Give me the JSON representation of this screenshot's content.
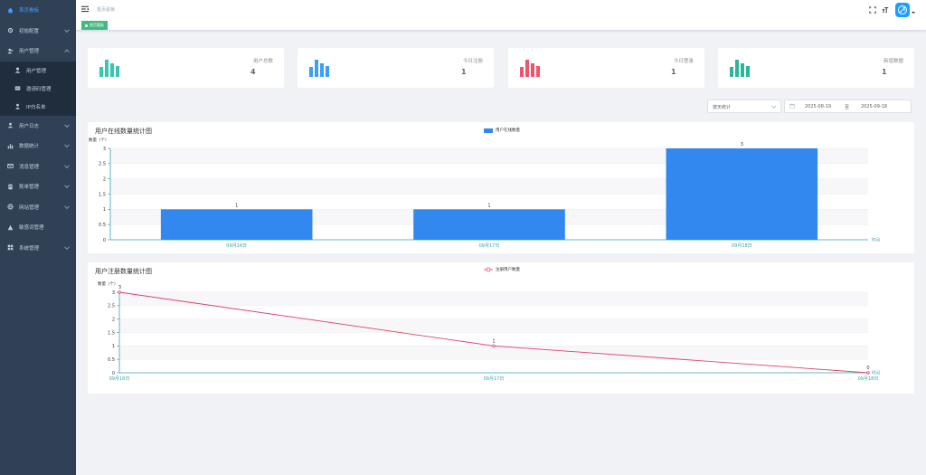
{
  "sidebar": {
    "items": [
      {
        "label": "首页看板",
        "icon": "home-icon",
        "active": true,
        "arrow": false
      },
      {
        "label": "初始配置",
        "icon": "settings-icon",
        "arrow": true
      },
      {
        "label": "用户管理",
        "icon": "users-icon",
        "arrow": true
      },
      {
        "label": "用户日志",
        "icon": "user-log-icon",
        "arrow": true
      },
      {
        "label": "数据统计",
        "icon": "stats-icon",
        "arrow": true
      },
      {
        "label": "消息管理",
        "icon": "message-icon",
        "arrow": true
      },
      {
        "label": "账单管理",
        "icon": "bill-icon",
        "arrow": true
      },
      {
        "label": "网站管理",
        "icon": "website-icon",
        "arrow": true
      },
      {
        "label": "敏感词管理",
        "icon": "sensitive-word-icon",
        "arrow": false
      },
      {
        "label": "系统管理",
        "icon": "system-icon",
        "arrow": true
      }
    ],
    "submenu": [
      {
        "label": "用户管理",
        "icon": "user-icon"
      },
      {
        "label": "邀请码管理",
        "icon": "invite-code-icon"
      },
      {
        "label": "IP白名单",
        "icon": "ip-whitelist-icon"
      }
    ]
  },
  "navbar": {
    "breadcrumb": "首页看板"
  },
  "tags": {
    "active": "首页看板"
  },
  "stats": [
    {
      "label": "用户总数",
      "value": "4",
      "color": "#36c6b3"
    },
    {
      "label": "今日注册",
      "value": "1",
      "color": "#3a9ff5"
    },
    {
      "label": "今日登录",
      "value": "1",
      "color": "#f4516c"
    },
    {
      "label": "新增数据",
      "value": "1",
      "color": "#2bb59a"
    }
  ],
  "filters": {
    "range_type": "按天统计",
    "start_date": "2025-08-19",
    "separator": "至",
    "end_date": "2025-09-18"
  },
  "colors": {
    "bar": "#3388f0",
    "line": "#e0406b",
    "axis": "#3aa1b4"
  },
  "chart_data": [
    {
      "type": "bar",
      "title": "用户在线数量统计图",
      "legend": "用户在线数量",
      "ylabel": "数量（个）",
      "xlabel": "时间",
      "categories": [
        "09月16日",
        "09月17日",
        "09月18日"
      ],
      "values": [
        1,
        1,
        3
      ],
      "ylim": [
        0,
        3
      ],
      "yticks": [
        "0",
        "0.5",
        "1",
        "1.5",
        "2",
        "2.5",
        "3"
      ]
    },
    {
      "type": "line",
      "title": "用户注册数量统计图",
      "legend": "注册用户数量",
      "ylabel": "数量（个）",
      "xlabel": "时间",
      "categories": [
        "09月16日",
        "09月17日",
        "09月18日"
      ],
      "values": [
        3,
        1,
        0
      ],
      "ylim": [
        0,
        3
      ],
      "yticks": [
        "0",
        "0.5",
        "1",
        "1.5",
        "2",
        "2.5",
        "3"
      ]
    }
  ]
}
